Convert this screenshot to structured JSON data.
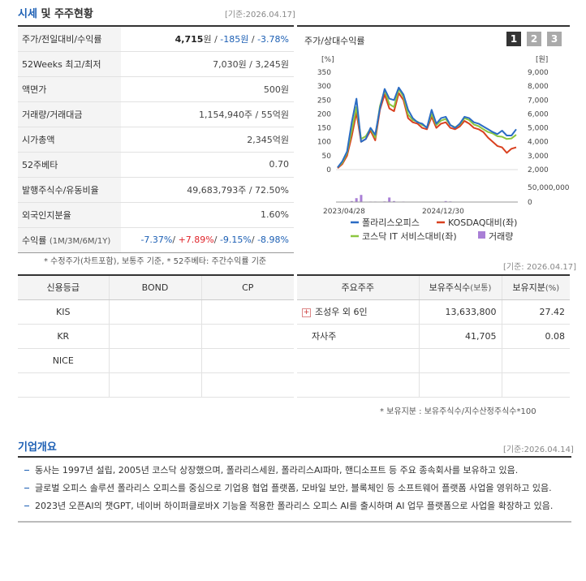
{
  "section1": {
    "title_blue": "시세",
    "title_rest": "및 주주현황",
    "base_date": "[기준:2026.04.17]"
  },
  "price_table": {
    "rows": [
      {
        "label": "주가/전일대비/수익률",
        "price": "4,715",
        "unit": "원",
        "sep": " / ",
        "change": "-185원",
        "sep2": " / ",
        "rate": "-3.78%"
      },
      {
        "label": "52Weeks 최고/최저",
        "value": "7,030원 / 3,245원"
      },
      {
        "label": "액면가",
        "value": "500원"
      },
      {
        "label": "거래량/거래대금",
        "value": "1,154,940주 / 55억원"
      },
      {
        "label": "시가총액",
        "value": "2,345억원"
      },
      {
        "label": "52주베타",
        "value": "0.70"
      },
      {
        "label": "발행주식수/유동비율",
        "value": "49,683,793주 / 72.50%"
      },
      {
        "label": "외국인지분율",
        "value": "1.60%"
      },
      {
        "label": "수익률",
        "label_small": "(1M/3M/6M/1Y)",
        "r1": "-7.37%",
        "r2": "+7.89%",
        "r3": "-9.15%",
        "r4": "-8.98%",
        "slash": "/ "
      }
    ],
    "note": "* 수정주가(차트포함), 보통주 기준, * 52주베타: 주간수익률 기준"
  },
  "chart_panel": {
    "title": "주가/상대수익률",
    "buttons": [
      "1",
      "2",
      "3"
    ],
    "active_button": "1",
    "left_unit": "[%]",
    "right_unit": "[원]",
    "volume_label": "50,000,000",
    "volume_zero": "0",
    "legend": [
      {
        "name": "폴라리스오피스",
        "color": "#2b6cc4",
        "kind": "line"
      },
      {
        "name": "KOSDAQ대비(좌)",
        "color": "#d9401f",
        "kind": "line"
      },
      {
        "name": "코스닥 IT 서비스대비(좌)",
        "color": "#8cc63f",
        "kind": "line"
      },
      {
        "name": "거래량",
        "color": "#a97fd6",
        "kind": "box"
      }
    ],
    "base_date": "[기준: 2026.04.17]"
  },
  "chart_data": {
    "type": "line",
    "x_ticks": [
      "2023/04/28",
      "2024/12/30"
    ],
    "y_left": {
      "ticks": [
        0,
        50,
        100,
        150,
        200,
        250,
        300,
        350
      ],
      "unit": "[%]",
      "ylim": [
        0,
        350
      ]
    },
    "y_right": {
      "ticks": [
        "2,000",
        "3,000",
        "4,000",
        "5,000",
        "6,000",
        "7,000",
        "8,000",
        "9,000"
      ],
      "unit": "[원]",
      "ylim": [
        2000,
        9000
      ]
    },
    "series": [
      {
        "name": "폴라리스오피스",
        "color": "#2b6cc4",
        "axis": "right",
        "values": [
          2150,
          2600,
          3300,
          5400,
          7100,
          4000,
          4200,
          5000,
          4500,
          6400,
          7800,
          7100,
          7000,
          7900,
          7400,
          6300,
          5700,
          5400,
          5300,
          5000,
          6300,
          5300,
          5700,
          5800,
          5200,
          5000,
          5300,
          5800,
          5700,
          5400,
          5300,
          5100,
          4900,
          4700,
          4550,
          4800,
          4450,
          4450,
          4900
        ]
      },
      {
        "name": "KOSDAQ대비(좌)",
        "color": "#d9401f",
        "axis": "left",
        "values": [
          5,
          20,
          50,
          120,
          205,
          100,
          110,
          140,
          105,
          215,
          270,
          220,
          210,
          275,
          250,
          185,
          170,
          165,
          150,
          145,
          190,
          150,
          165,
          170,
          150,
          145,
          155,
          175,
          165,
          150,
          145,
          135,
          115,
          100,
          85,
          80,
          60,
          75,
          80
        ]
      },
      {
        "name": "코스닥 IT 서비스대비(좌)",
        "color": "#8cc63f",
        "axis": "left",
        "values": [
          8,
          25,
          60,
          140,
          225,
          110,
          120,
          148,
          115,
          228,
          285,
          235,
          225,
          290,
          262,
          198,
          178,
          172,
          160,
          152,
          200,
          160,
          176,
          182,
          160,
          152,
          162,
          185,
          178,
          162,
          156,
          145,
          135,
          130,
          120,
          118,
          110,
          112,
          125
        ]
      }
    ],
    "volume": {
      "name": "거래량",
      "color": "#a97fd6",
      "ylim": [
        0,
        50000000
      ],
      "values": [
        0,
        0,
        0,
        3000000,
        12000000,
        22000000,
        1000000,
        1500000,
        1500000,
        0,
        2000000,
        14000000,
        3000000,
        1000000,
        1500000,
        0,
        0,
        0,
        0,
        0,
        0,
        0,
        0,
        3000000,
        2000000,
        0,
        0,
        0,
        0,
        0,
        0,
        0,
        0,
        0,
        0,
        0,
        0,
        0,
        0
      ]
    }
  },
  "credit": {
    "headers": [
      "신용등급",
      "BOND",
      "CP"
    ],
    "rows": [
      [
        "KIS",
        "",
        ""
      ],
      [
        "KR",
        "",
        ""
      ],
      [
        "NICE",
        "",
        ""
      ],
      [
        "",
        "",
        ""
      ]
    ]
  },
  "holders": {
    "headers": [
      "주요주주",
      "보유주식수",
      "(보통)",
      "보유지분",
      "(%)"
    ],
    "rows": [
      {
        "name": "조성우 외 6인",
        "shares": "13,633,800",
        "pct": "27.42",
        "expand": "+"
      },
      {
        "name": "자사주",
        "shares": "41,705",
        "pct": "0.08",
        "expand": ""
      },
      {
        "name": "",
        "shares": "",
        "pct": "",
        "expand": ""
      },
      {
        "name": "",
        "shares": "",
        "pct": "",
        "expand": ""
      }
    ],
    "note": "* 보유지분 : 보유주식수/지수산정주식수*100"
  },
  "overview": {
    "title": "기업개요",
    "base_date": "[기준:2026.04.14]",
    "items": [
      "동사는 1997년 설립, 2005년 코스닥 상장했으며, 폴라리스세원, 폴라리스AI파마, 핸디소프트 등 주요 종속회사를 보유하고 있음.",
      "글로벌 오피스 솔루션 폴라리스 오피스를 중심으로 기업용 협업 플랫폼, 모바일 보안, 블록체인 등 소프트웨어 플랫폼 사업을 영위하고 있음.",
      "2023년 오픈AI의 챗GPT, 네이버 하이퍼클로바X 기능을 적용한 폴라리스 오피스 AI를 출시하며 AI 업무 플랫폼으로 사업을 확장하고 있음."
    ]
  }
}
